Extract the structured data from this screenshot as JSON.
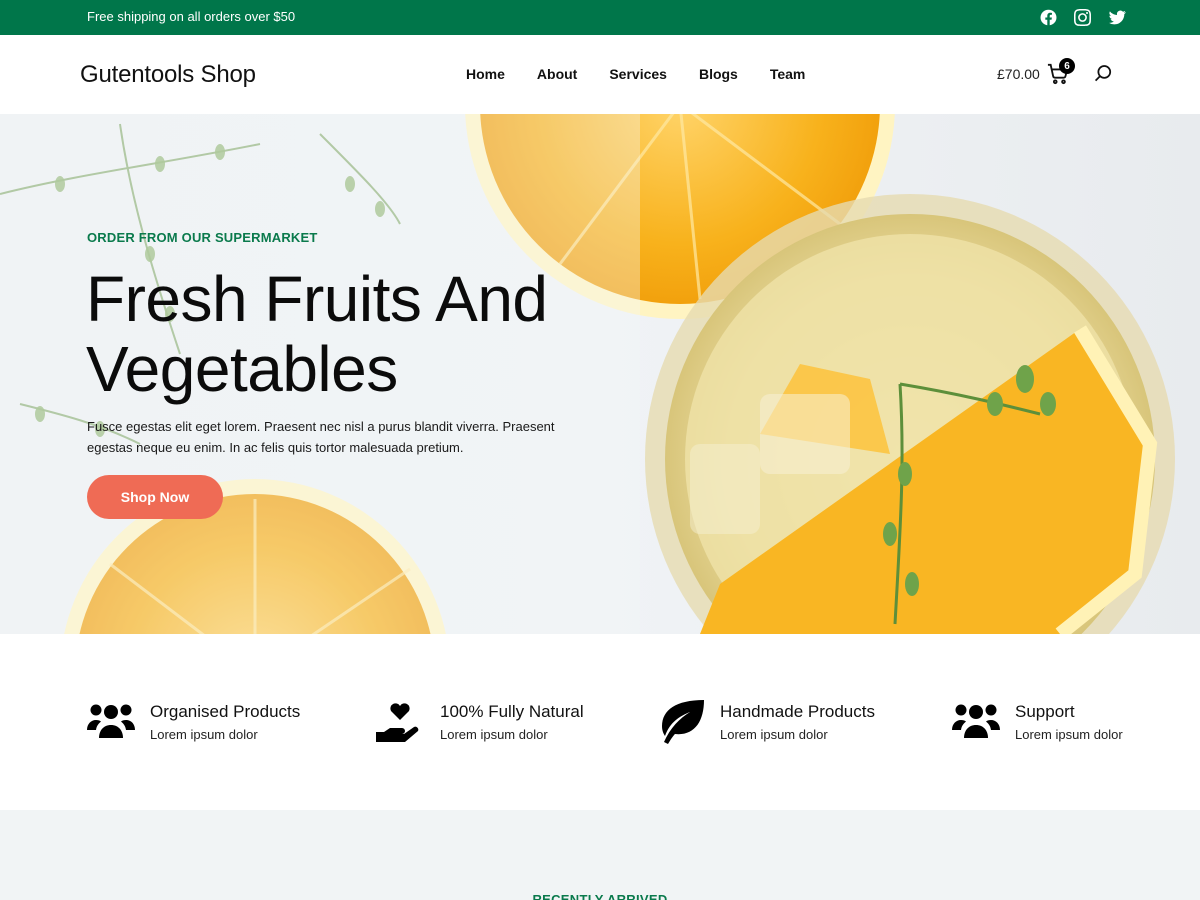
{
  "topbar": {
    "text": "Free shipping on all orders over $50",
    "social": [
      "facebook-icon",
      "instagram-icon",
      "twitter-icon"
    ],
    "bg_color": "#00764a"
  },
  "header": {
    "logo": "Gutentools Shop",
    "nav": [
      "Home",
      "About",
      "Services",
      "Blogs",
      "Team"
    ],
    "cart_total": "£70.00",
    "cart_count": "6"
  },
  "hero": {
    "eyebrow": "ORDER FROM OUR SUPERMARKET",
    "title": "Fresh Fruits And Vegetables",
    "description": "Fusce egestas elit eget lorem. Praesent nec nisl a purus blandit viverra. Praesent egestas neque eu enim. In ac felis quis tortor malesuada pretium.",
    "button": "Shop Now",
    "accent_color": "#0a7a4c",
    "button_color": "#ef6b55"
  },
  "features": [
    {
      "icon": "users-icon",
      "title": "Organised Products",
      "subtitle": "Lorem ipsum dolor"
    },
    {
      "icon": "hand-heart-icon",
      "title": "100% Fully Natural",
      "subtitle": "Lorem ipsum dolor"
    },
    {
      "icon": "leaf-icon",
      "title": "Handmade Products",
      "subtitle": "Lorem ipsum dolor"
    },
    {
      "icon": "users-icon",
      "title": "Support",
      "subtitle": "Lorem ipsum dolor"
    }
  ],
  "recent": {
    "label": "RECENTLY ARRIVED"
  }
}
